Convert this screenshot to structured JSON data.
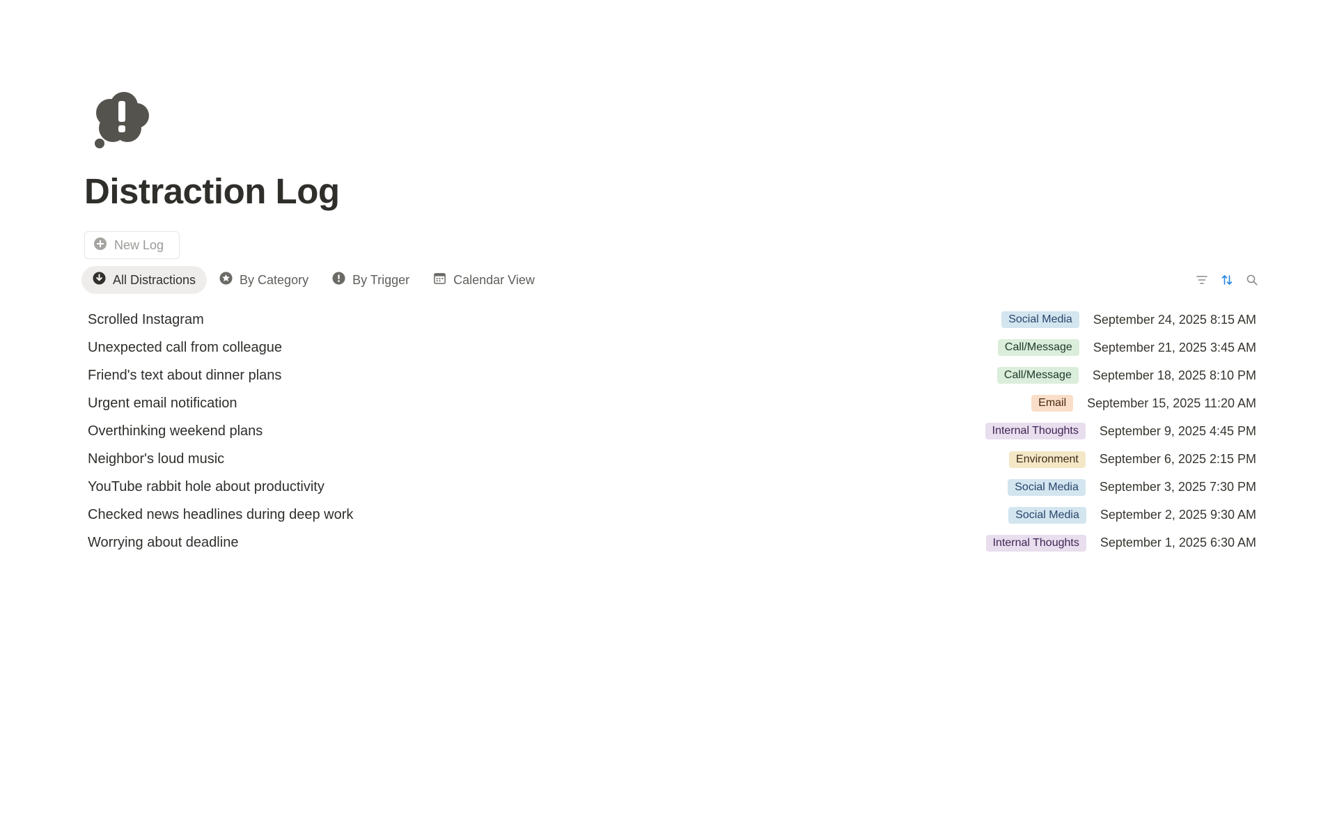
{
  "page": {
    "icon": "thought-bubble-exclamation-icon",
    "title": "Distraction Log"
  },
  "new_button": {
    "label": "New Log",
    "icon": "plus-circle-icon"
  },
  "tabs": [
    {
      "label": "All Distractions",
      "icon": "arrow-down-circle-icon",
      "active": true
    },
    {
      "label": "By Category",
      "icon": "star-circle-icon",
      "active": false
    },
    {
      "label": "By Trigger",
      "icon": "exclamation-circle-icon",
      "active": false
    },
    {
      "label": "Calendar View",
      "icon": "calendar-icon",
      "active": false
    }
  ],
  "tools": [
    {
      "icon": "filter-icon"
    },
    {
      "icon": "sort-icon",
      "color": "#2383e2"
    },
    {
      "icon": "search-icon"
    }
  ],
  "tag_colors": {
    "Social Media": {
      "bg": "#d3e5ef",
      "fg": "#28456c"
    },
    "Call/Message": {
      "bg": "#dbeddb",
      "fg": "#1c3829"
    },
    "Email": {
      "bg": "#fadec9",
      "fg": "#49290e"
    },
    "Internal Thoughts": {
      "bg": "#e8deee",
      "fg": "#412454"
    },
    "Environment": {
      "bg": "#f3e7c6",
      "fg": "#402c1b"
    }
  },
  "rows": [
    {
      "title": "Scrolled Instagram",
      "category": "Social Media",
      "date": "September 24, 2025 8:15 AM"
    },
    {
      "title": "Unexpected call from colleague",
      "category": "Call/Message",
      "date": "September 21, 2025 3:45 AM"
    },
    {
      "title": "Friend's text about dinner plans",
      "category": "Call/Message",
      "date": "September 18, 2025 8:10 PM"
    },
    {
      "title": "Urgent email notification",
      "category": "Email",
      "date": "September 15, 2025 11:20 AM"
    },
    {
      "title": "Overthinking weekend plans",
      "category": "Internal Thoughts",
      "date": "September 9, 2025 4:45 PM"
    },
    {
      "title": "Neighbor's loud music",
      "category": "Environment",
      "date": "September 6, 2025 2:15 PM"
    },
    {
      "title": "YouTube rabbit hole about productivity",
      "category": "Social Media",
      "date": "September 3, 2025 7:30 PM"
    },
    {
      "title": "Checked news headlines during deep work",
      "category": "Social Media",
      "date": "September 2, 2025 9:30 AM"
    },
    {
      "title": "Worrying about deadline",
      "category": "Internal Thoughts",
      "date": "September 1, 2025 6:30 AM"
    }
  ]
}
